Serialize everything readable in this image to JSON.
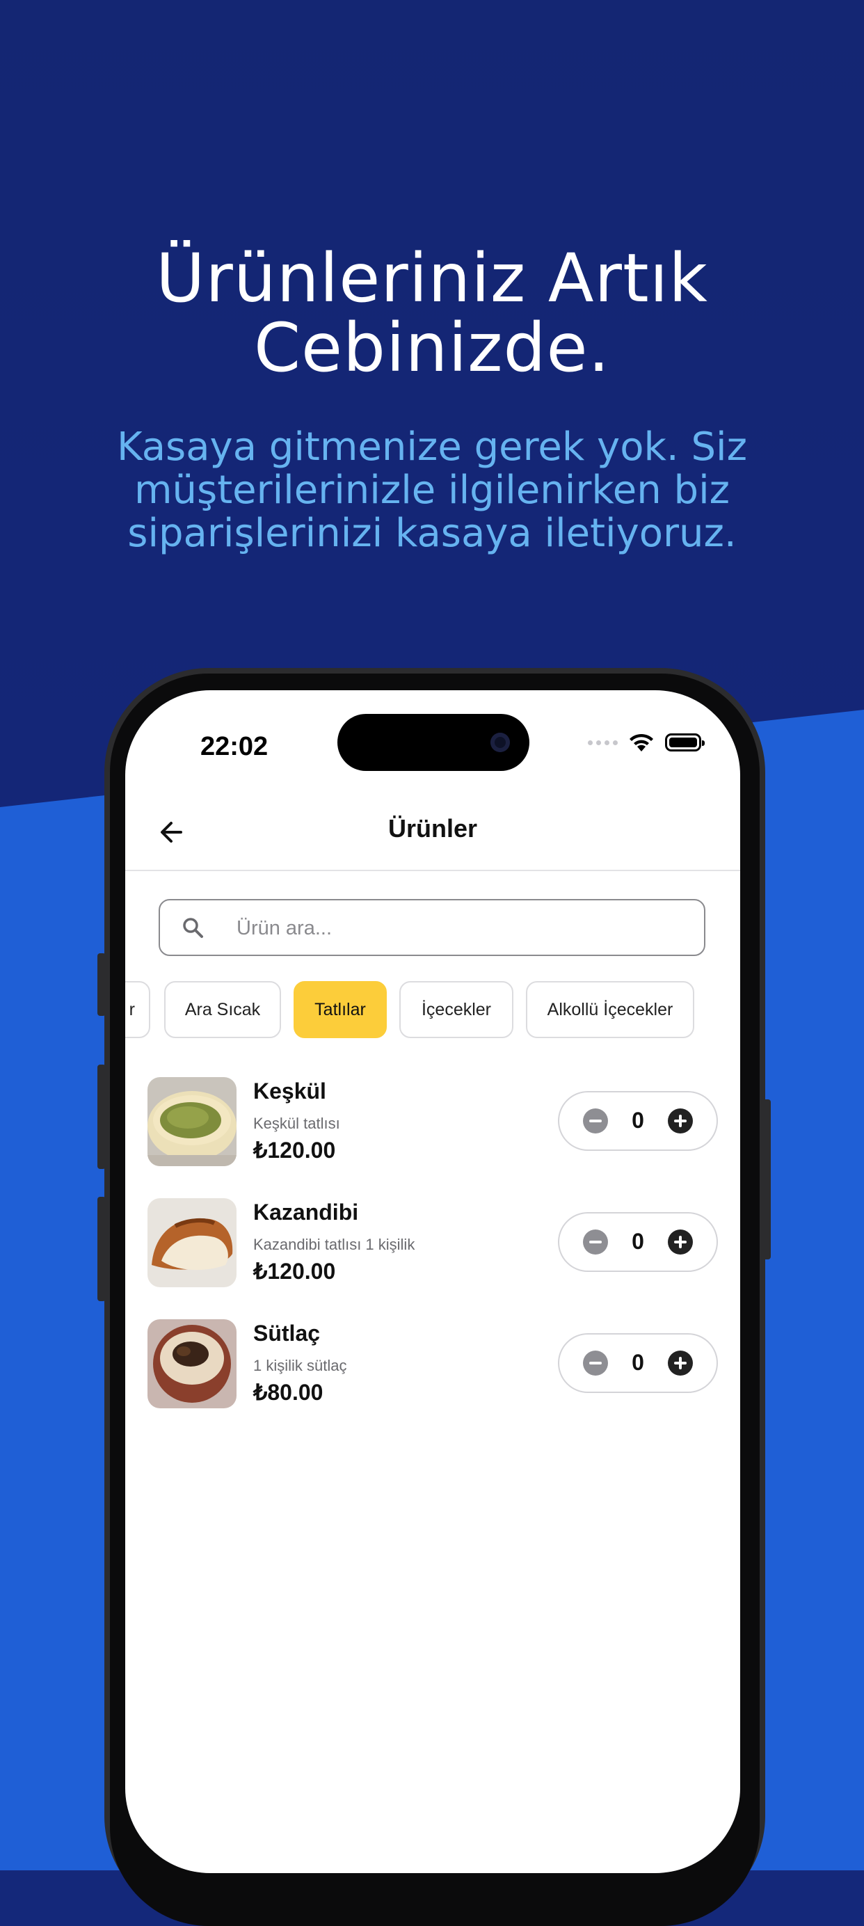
{
  "hero": {
    "title_line1": "Ürünleriniz Artık",
    "title_line2": "Cebinizde.",
    "subtitle_line1": "Kasaya gitmenize gerek yok. Siz",
    "subtitle_line2": "müşterilerinizle ilgilenirken biz",
    "subtitle_line3": "siparişlerinizi kasaya iletiyoruz."
  },
  "colors": {
    "background_top": "#142673",
    "background_bottom": "#1f5fd6",
    "subtitle": "#66b3f0",
    "active_chip": "#fccd3a"
  },
  "status_bar": {
    "time": "22:02"
  },
  "nav": {
    "title": "Ürünler",
    "back_icon": "arrow-left-icon"
  },
  "search": {
    "placeholder": "Ürün ara...",
    "icon": "search-icon"
  },
  "categories": [
    {
      "label": "r",
      "active": false
    },
    {
      "label": "Ara Sıcak",
      "active": false
    },
    {
      "label": "Tatlılar",
      "active": true
    },
    {
      "label": "İçecekler",
      "active": false
    },
    {
      "label": "Alkollü İçecekler",
      "active": false
    }
  ],
  "products": [
    {
      "name": "Keşkül",
      "description": "Keşkül tatlısı",
      "price": "₺120.00",
      "quantity": "0"
    },
    {
      "name": "Kazandibi",
      "description": "Kazandibi tatlısı 1 kişilik",
      "price": "₺120.00",
      "quantity": "0"
    },
    {
      "name": "Sütlaç",
      "description": "1 kişilik sütlaç",
      "price": "₺80.00",
      "quantity": "0"
    }
  ]
}
